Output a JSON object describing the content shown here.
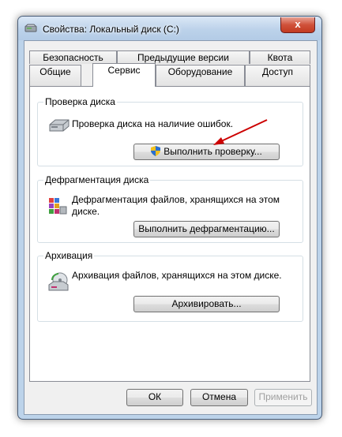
{
  "window": {
    "title": "Свойства: Локальный диск (C:)",
    "close_label": "x"
  },
  "tabs_row1": [
    "Безопасность",
    "Предыдущие версии",
    "Квота"
  ],
  "tabs_row2": [
    "Общие",
    "Сервис",
    "Оборудование",
    "Доступ"
  ],
  "active_tab": "Сервис",
  "groups": {
    "check": {
      "title": "Проверка диска",
      "text": "Проверка диска на наличие ошибок.",
      "button": "Выполнить проверку..."
    },
    "defrag": {
      "title": "Дефрагментация диска",
      "text": "Дефрагментация файлов, хранящихся на этом диске.",
      "button": "Выполнить дефрагментацию..."
    },
    "backup": {
      "title": "Архивация",
      "text": "Архивация файлов, хранящихся на этом диске.",
      "button": "Архивировать..."
    }
  },
  "footer": {
    "ok": "ОК",
    "cancel": "Отмена",
    "apply": "Применить"
  },
  "colors": {
    "arrow": "#cc0000",
    "frame": "#bcd3ea",
    "close": "#c23a20"
  }
}
